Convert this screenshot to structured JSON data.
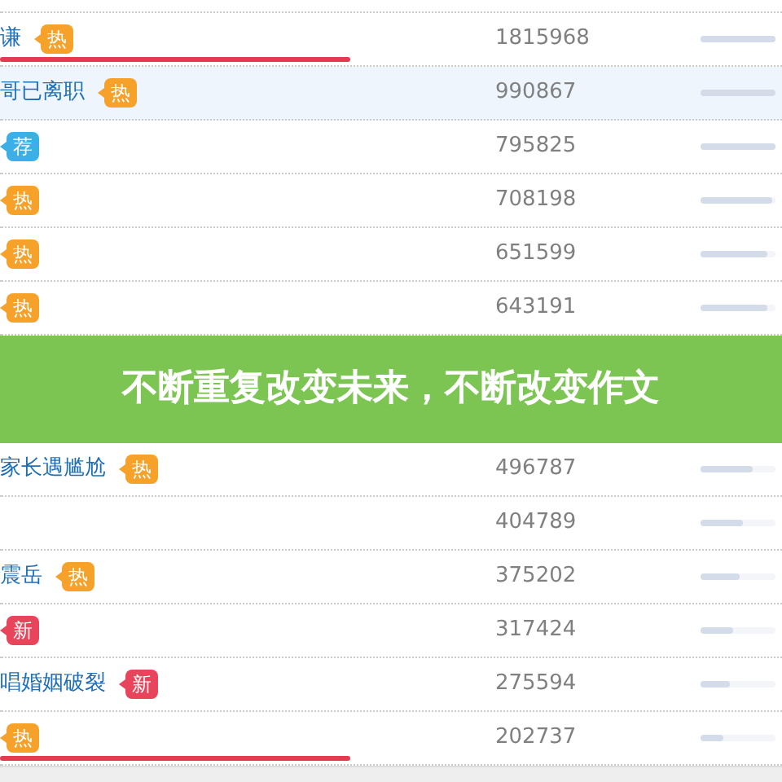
{
  "rows": [
    {
      "name": "谦",
      "tag": {
        "kind": "hot",
        "text": "热"
      },
      "count": "1815968",
      "level": 1.0,
      "highlighted": false,
      "underlined": true
    },
    {
      "name": "哥已离职",
      "tag": {
        "kind": "hot",
        "text": "热"
      },
      "count": "990867",
      "level": 1.0,
      "highlighted": true,
      "underlined": false
    },
    {
      "tag": {
        "kind": "recommended",
        "text": "荐"
      },
      "count": "795825",
      "level": 1.0,
      "highlighted": false,
      "underlined": false
    },
    {
      "tag": {
        "kind": "hot",
        "text": "热"
      },
      "count": "708198",
      "level": 0.96,
      "highlighted": false,
      "underlined": false
    },
    {
      "tag": {
        "kind": "hot",
        "text": "热"
      },
      "count": "651599",
      "level": 0.9,
      "highlighted": false,
      "underlined": false
    },
    {
      "tag": {
        "kind": "hot",
        "text": "热"
      },
      "count": "643191",
      "level": 0.9,
      "highlighted": false,
      "underlined": false
    },
    {
      "name": "家长遇尴尬",
      "tag": {
        "kind": "hot",
        "text": "热"
      },
      "count": "496787",
      "level": 0.7,
      "highlighted": false,
      "underlined": false
    },
    {
      "count": "404789",
      "level": 0.56,
      "highlighted": false,
      "underlined": false
    },
    {
      "name": "震岳",
      "tag": {
        "kind": "hot",
        "text": "热"
      },
      "count": "375202",
      "level": 0.52,
      "highlighted": false,
      "underlined": false
    },
    {
      "tag": {
        "kind": "new",
        "text": "新"
      },
      "count": "317424",
      "level": 0.44,
      "highlighted": false,
      "underlined": false
    },
    {
      "name": "唱婚姻破裂",
      "tag": {
        "kind": "new",
        "text": "新"
      },
      "count": "275594",
      "level": 0.4,
      "highlighted": false,
      "underlined": false
    },
    {
      "tag": {
        "kind": "hot",
        "text": "热"
      },
      "count": "202737",
      "level": 0.3,
      "highlighted": false,
      "underlined": true
    }
  ],
  "banner": {
    "title": "不断重复改变未来，不断改变作文"
  }
}
